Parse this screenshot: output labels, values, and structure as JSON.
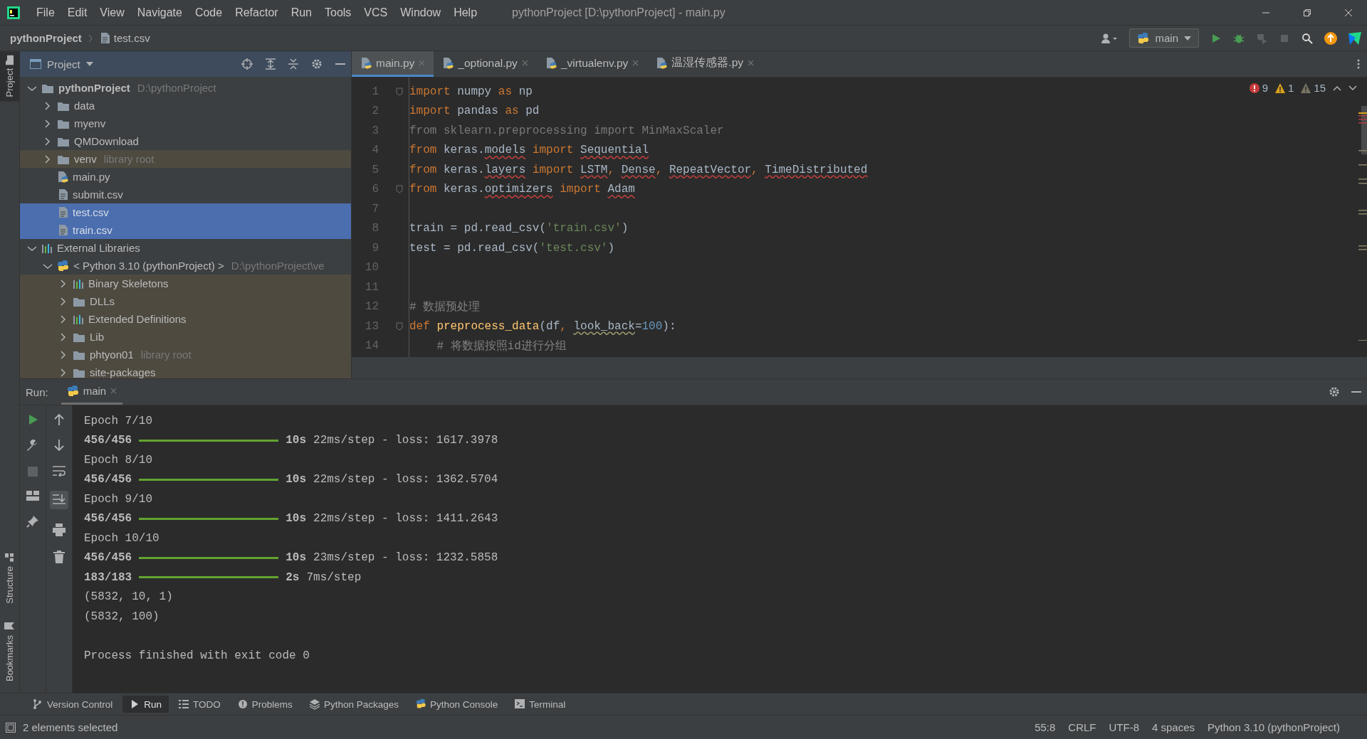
{
  "window": {
    "title": "pythonProject [D:\\pythonProject] - main.py",
    "menu": [
      "File",
      "Edit",
      "View",
      "Navigate",
      "Code",
      "Refactor",
      "Run",
      "Tools",
      "VCS",
      "Window",
      "Help"
    ]
  },
  "navbar": {
    "breadcrumbs": [
      {
        "label": "pythonProject",
        "kind": "project"
      },
      {
        "label": "test.csv",
        "kind": "file"
      }
    ],
    "run_config": "main"
  },
  "left_stripe": {
    "top": [
      {
        "label": "Project",
        "selected": true
      }
    ],
    "bottom": [
      {
        "label": "Structure",
        "selected": false
      },
      {
        "label": "Bookmarks",
        "selected": false
      }
    ]
  },
  "project_panel": {
    "title": "Project",
    "tree": [
      {
        "name": "pythonProject",
        "hint": "D:\\pythonProject",
        "kind": "module",
        "expanded": true,
        "selected": false,
        "tinted": false,
        "children": [
          {
            "name": "data",
            "kind": "folder",
            "expanded": false,
            "selected": false,
            "tinted": false
          },
          {
            "name": "myenv",
            "kind": "folder",
            "expanded": false,
            "selected": false,
            "tinted": false
          },
          {
            "name": "QMDownload",
            "kind": "folder",
            "expanded": false,
            "selected": false,
            "tinted": false
          },
          {
            "name": "venv",
            "hint": "library root",
            "kind": "folder",
            "expanded": false,
            "selected": false,
            "tinted": true
          },
          {
            "name": "main.py",
            "kind": "python-file",
            "selected": false,
            "tinted": false
          },
          {
            "name": "submit.csv",
            "kind": "text-file",
            "selected": false,
            "tinted": false
          },
          {
            "name": "test.csv",
            "kind": "text-file",
            "selected": true,
            "tinted": false
          },
          {
            "name": "train.csv",
            "kind": "text-file",
            "selected": true,
            "tinted": false
          }
        ]
      },
      {
        "name": "External Libraries",
        "kind": "library",
        "expanded": true,
        "selected": false,
        "tinted": false,
        "children": [
          {
            "name": "< Python 3.10 (pythonProject) >",
            "hint": "D:\\pythonProject\\ve",
            "kind": "python",
            "expanded": true,
            "selected": false,
            "tinted": false,
            "children": [
              {
                "name": "Binary Skeletons",
                "kind": "library",
                "expanded": false,
                "selected": false,
                "tinted": true
              },
              {
                "name": "DLLs",
                "kind": "folder",
                "expanded": false,
                "selected": false,
                "tinted": true
              },
              {
                "name": "Extended Definitions",
                "kind": "library",
                "expanded": false,
                "selected": false,
                "tinted": true
              },
              {
                "name": "Lib",
                "kind": "folder",
                "expanded": false,
                "selected": false,
                "tinted": true
              },
              {
                "name": "phtyon01",
                "hint": "library root",
                "kind": "folder",
                "expanded": false,
                "selected": false,
                "tinted": true
              },
              {
                "name": "site-packages",
                "kind": "folder",
                "expanded": false,
                "selected": false,
                "tinted": true
              }
            ]
          }
        ]
      }
    ]
  },
  "editor": {
    "tabs": [
      {
        "label": "main.py",
        "selected": true
      },
      {
        "label": "_optional.py",
        "selected": false
      },
      {
        "label": "_virtualenv.py",
        "selected": false
      },
      {
        "label": "温湿传感器.py",
        "selected": false
      }
    ],
    "inspections": [
      {
        "kind": "error",
        "count": "9"
      },
      {
        "kind": "warning",
        "count": "1"
      },
      {
        "kind": "weak",
        "count": "15"
      }
    ],
    "lines": [
      {
        "number": "1",
        "fold": true,
        "tokens": [
          {
            "text": "import",
            "kind": "keyword"
          },
          {
            "text": " numpy ",
            "kind": "name"
          },
          {
            "text": "as",
            "kind": "keyword"
          },
          {
            "text": " np",
            "kind": "name"
          }
        ]
      },
      {
        "number": "2",
        "fold": false,
        "tokens": [
          {
            "text": "import",
            "kind": "keyword"
          },
          {
            "text": " pandas ",
            "kind": "name"
          },
          {
            "text": "as",
            "kind": "keyword"
          },
          {
            "text": " pd",
            "kind": "name"
          }
        ]
      },
      {
        "number": "3",
        "fold": false,
        "tokens": [
          {
            "text": "from sklearn.preprocessing import MinMaxScaler",
            "kind": "unused"
          }
        ]
      },
      {
        "number": "4",
        "fold": false,
        "tokens": [
          {
            "text": "from",
            "kind": "keyword"
          },
          {
            "text": " keras.",
            "kind": "name"
          },
          {
            "text": "models",
            "kind": "unresolved"
          },
          {
            "text": " import ",
            "kind": "keyword"
          },
          {
            "text": "Sequential",
            "kind": "unresolved"
          }
        ]
      },
      {
        "number": "5",
        "fold": false,
        "tokens": [
          {
            "text": "from",
            "kind": "keyword"
          },
          {
            "text": " keras.",
            "kind": "name"
          },
          {
            "text": "layers",
            "kind": "unresolved"
          },
          {
            "text": " import ",
            "kind": "keyword"
          },
          {
            "text": "LSTM",
            "kind": "unresolved"
          },
          {
            "text": ", ",
            "kind": "keyword"
          },
          {
            "text": "Dense",
            "kind": "unresolved"
          },
          {
            "text": ", ",
            "kind": "keyword"
          },
          {
            "text": "RepeatVector",
            "kind": "unresolved"
          },
          {
            "text": ", ",
            "kind": "keyword"
          },
          {
            "text": "TimeDistributed",
            "kind": "unresolved"
          }
        ]
      },
      {
        "number": "6",
        "fold": true,
        "tokens": [
          {
            "text": "from",
            "kind": "keyword"
          },
          {
            "text": " keras.",
            "kind": "name"
          },
          {
            "text": "optimizers",
            "kind": "unresolved"
          },
          {
            "text": " import ",
            "kind": "keyword"
          },
          {
            "text": "Adam",
            "kind": "unresolved"
          }
        ]
      },
      {
        "number": "7",
        "fold": false
      },
      {
        "number": "8",
        "fold": false,
        "tokens": [
          {
            "text": "train = pd.read_csv(",
            "kind": "name"
          },
          {
            "text": "'train.csv'",
            "kind": "string"
          },
          {
            "text": ")",
            "kind": "name"
          }
        ]
      },
      {
        "number": "9",
        "fold": false,
        "tokens": [
          {
            "text": "test = pd.read_csv(",
            "kind": "name"
          },
          {
            "text": "'test.csv'",
            "kind": "string"
          },
          {
            "text": ")",
            "kind": "name"
          }
        ]
      },
      {
        "number": "10",
        "fold": false
      },
      {
        "number": "11",
        "fold": false
      },
      {
        "number": "12",
        "fold": false,
        "tokens": [
          {
            "text": "# 数据预处理",
            "kind": "comment"
          }
        ]
      },
      {
        "number": "13",
        "fold": true,
        "tokens": [
          {
            "text": "def ",
            "kind": "keyword"
          },
          {
            "text": "preprocess_data",
            "kind": "function"
          },
          {
            "text": "(df",
            "kind": "name"
          },
          {
            "text": ", ",
            "kind": "keyword"
          },
          {
            "text": "look_back",
            "kind": "weak"
          },
          {
            "text": "=",
            "kind": "name"
          },
          {
            "text": "100",
            "kind": "number"
          },
          {
            "text": "):",
            "kind": "name"
          }
        ]
      },
      {
        "number": "14",
        "fold": false,
        "tokens": [
          {
            "text": "    # 将数据按照id进行分组",
            "kind": "comment"
          }
        ]
      }
    ]
  },
  "run_panel": {
    "label": "Run:",
    "tab": "main",
    "output": [
      {
        "kind": "text",
        "text": "Epoch 7/10"
      },
      {
        "kind": "progress",
        "count": "456/456",
        "level": 1,
        "time": "10s",
        "rest": "22ms/step - loss: 1617.3978"
      },
      {
        "kind": "text",
        "text": "Epoch 8/10"
      },
      {
        "kind": "progress",
        "count": "456/456",
        "level": 1,
        "time": "10s",
        "rest": "22ms/step - loss: 1362.5704"
      },
      {
        "kind": "text",
        "text": "Epoch 9/10"
      },
      {
        "kind": "progress",
        "count": "456/456",
        "level": 1,
        "time": "10s",
        "rest": "22ms/step - loss: 1411.2643"
      },
      {
        "kind": "text",
        "text": "Epoch 10/10"
      },
      {
        "kind": "progress",
        "count": "456/456",
        "level": 1,
        "time": "10s",
        "rest": "23ms/step - loss: 1232.5858"
      },
      {
        "kind": "progress",
        "count": "183/183",
        "level": 1,
        "time": "2s",
        "rest": "7ms/step"
      },
      {
        "kind": "text",
        "text": "(5832, 10, 1)"
      },
      {
        "kind": "text",
        "text": "(5832, 100)"
      },
      {
        "kind": "blank"
      },
      {
        "kind": "text",
        "text": "Process finished with exit code 0"
      }
    ]
  },
  "tool_tabs": [
    {
      "label": "Version Control",
      "kind": "branch",
      "selected": false
    },
    {
      "label": "Run",
      "kind": "play",
      "selected": true
    },
    {
      "label": "TODO",
      "kind": "list",
      "selected": false
    },
    {
      "label": "Problems",
      "kind": "alert",
      "selected": false
    },
    {
      "label": "Python Packages",
      "kind": "layers",
      "selected": false
    },
    {
      "label": "Python Console",
      "kind": "python",
      "selected": false
    },
    {
      "label": "Terminal",
      "kind": "terminal",
      "selected": false
    }
  ],
  "status_bar": {
    "message": "2 elements selected",
    "items": [
      "55:8",
      "CRLF",
      "UTF-8",
      "4 spaces",
      "Python 3.10 (pythonProject)"
    ]
  }
}
